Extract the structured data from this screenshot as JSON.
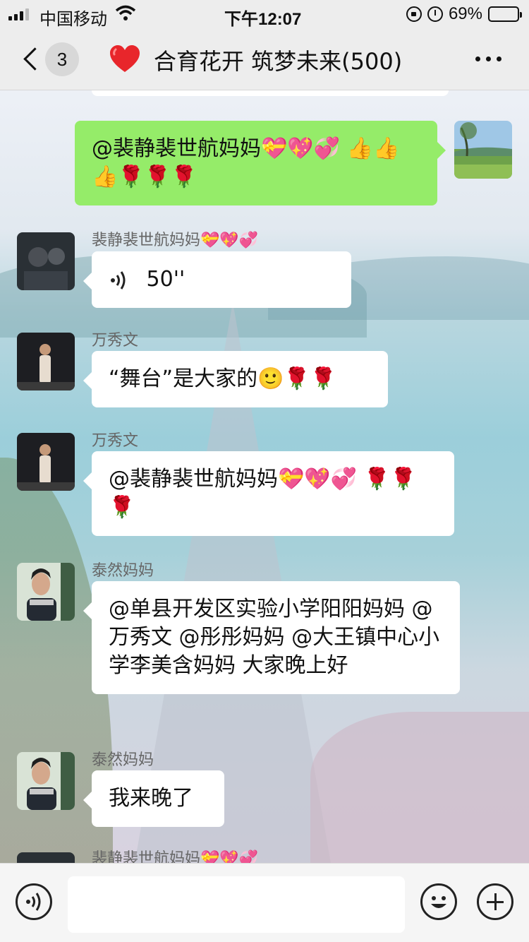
{
  "status_bar": {
    "carrier": "中国移动",
    "time": "下午12:07",
    "battery_percent": "69%",
    "battery_level": 0.69
  },
  "header": {
    "unread_count": "3",
    "title": "合育花开 筑梦未来(500)",
    "heart_icon": "red-heart-icon",
    "back_icon": "chevron-left-icon",
    "more_icon": "more-dots-icon"
  },
  "messages": [
    {
      "id": "m1",
      "side": "right",
      "text": "@裴静裴世航妈妈💝💖💞 👍👍👍🌹🌹🌹"
    },
    {
      "id": "m2",
      "side": "left",
      "sender": "裴静裴世航妈妈💝💖💞",
      "type": "voice",
      "duration": "50''"
    },
    {
      "id": "m3",
      "side": "left",
      "sender": "万秀文",
      "text": "“舞台”是大家的🙂🌹🌹"
    },
    {
      "id": "m4",
      "side": "left",
      "sender": "万秀文",
      "text": "@裴静裴世航妈妈💝💖💞 🌹🌹🌹"
    },
    {
      "id": "m5",
      "side": "left",
      "sender": "泰然妈妈",
      "text": "@单县开发区实验小学阳阳妈妈 @万秀文 @彤彤妈妈 @大王镇中心小学李美含妈妈 大家晚上好"
    },
    {
      "id": "m6",
      "side": "left",
      "sender": "泰然妈妈",
      "text": "我来晚了"
    },
    {
      "id": "m7",
      "side": "left",
      "sender": "裴静裴世航妈妈💝💖💞"
    }
  ],
  "input_bar": {
    "voice_icon": "voice-input-icon",
    "emoji_icon": "smiley-icon",
    "plus_icon": "plus-icon",
    "input_value": ""
  }
}
